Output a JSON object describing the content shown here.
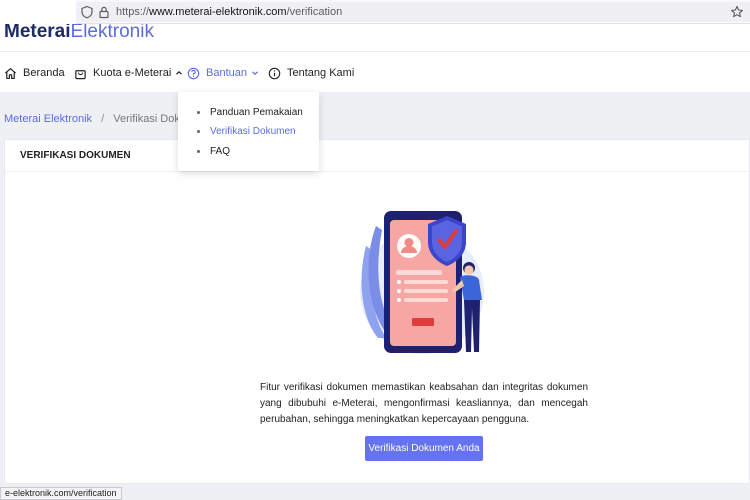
{
  "browser": {
    "url_scheme": "https://",
    "url_domain": "www.meterai-elektronik.com",
    "url_path": "/verification"
  },
  "header": {
    "logo_bold": "Meterai",
    "logo_light": "Elektronik"
  },
  "nav": {
    "items": [
      {
        "label": "Beranda",
        "icon": "home-icon"
      },
      {
        "label": "Kuota e-Meterai",
        "icon": "shopping-bag-icon"
      },
      {
        "label": "Bantuan",
        "icon": "help-circle-icon"
      },
      {
        "label": "Tentang Kami",
        "icon": "info-icon"
      }
    ]
  },
  "dropdown": {
    "items": [
      {
        "label": "Panduan Pemakaian"
      },
      {
        "label": "Verifikasi Dokumen"
      },
      {
        "label": "FAQ"
      }
    ]
  },
  "breadcrumb": {
    "parent": "Meterai Elektronik",
    "separator": "/",
    "current": "Verifikasi Dokumen"
  },
  "card": {
    "title": "VERIFIKASI DOKUMEN",
    "description": "Fitur verifikasi dokumen memastikan keabsahan dan integritas dokumen yang dibubuhi e-Meterai, mengonfirmasi keasliannya, dan mencegah perubahan, sehingga meningkatkan kepercayaan pengguna.",
    "button_label": "Verifikasi Dokumen Anda"
  },
  "status_bar": {
    "link_preview": "e-elektronik.com/verification"
  },
  "colors": {
    "accent": "#5a6de0",
    "button": "#6573f0",
    "logo_dark": "#1e2a66",
    "phone": "#1d2170",
    "screen": "#f6a7a3",
    "shield": "#3c44c9",
    "check": "#e03b3b"
  }
}
